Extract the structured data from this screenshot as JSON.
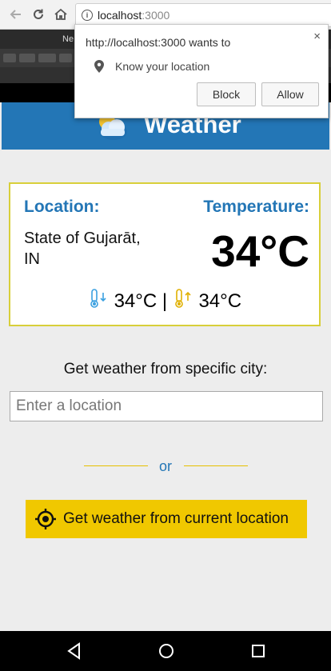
{
  "browser": {
    "url_host": "localhost",
    "url_port": ":3000",
    "tab_text": "Ne"
  },
  "permission_popup": {
    "message": "http://localhost:3000 wants to",
    "permission": "Know your location",
    "block_label": "Block",
    "allow_label": "Allow",
    "close_glyph": "×"
  },
  "header": {
    "title": "Weather",
    "color": "#2376b6"
  },
  "weather_card": {
    "location_label": "Location:",
    "location_line1": "State of Gujarāt,",
    "location_line2": "IN",
    "temperature_label": "Temperature:",
    "temperature": "34°C",
    "min_temp": "34°C",
    "separator": "|",
    "max_temp": "34°C",
    "border_color": "#d8cf3a"
  },
  "city_search": {
    "label": "Get weather from specific city:",
    "placeholder": "Enter a location",
    "value": ""
  },
  "divider": {
    "text": "or"
  },
  "location_button": {
    "label": "Get weather from current location",
    "color": "#f0c800"
  },
  "icons": {
    "back": "arrow-left-icon",
    "reload": "reload-icon",
    "home": "home-icon",
    "info": "info-icon",
    "location_pin": "location-pin-icon",
    "weather": "sun-cloud-icon",
    "thermometer_min": "thermometer-down-icon",
    "thermometer_max": "thermometer-up-icon",
    "crosshair": "crosshair-target-icon",
    "android_back": "triangle-back-icon",
    "android_home": "circle-home-icon",
    "android_recents": "square-recents-icon"
  }
}
